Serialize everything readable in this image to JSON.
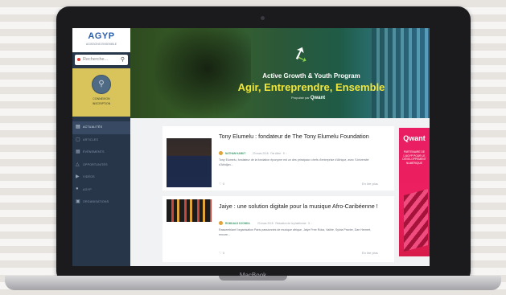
{
  "device": {
    "brand": "MacBook"
  },
  "sidebar": {
    "logo": "AGYP",
    "logo_sub": "AGISSONS ENSEMBLE",
    "search_placeholder": "Recherche...",
    "profile_lines": [
      "CONNEXION",
      "INSCRIPTION"
    ],
    "items": [
      {
        "icon": "news-icon",
        "label": "ACTUALITÉS"
      },
      {
        "icon": "doc-icon",
        "label": "ARTICLES"
      },
      {
        "icon": "calendar-icon",
        "label": "ÉVÉNEMENTS"
      },
      {
        "icon": "alert-icon",
        "label": "OPPORTUNITÉS"
      },
      {
        "icon": "video-icon",
        "label": "VIDÉOS"
      },
      {
        "icon": "info-icon",
        "label": "AGYP"
      },
      {
        "icon": "grid-icon",
        "label": "ORGANISATIONS"
      }
    ]
  },
  "hero": {
    "subtitle": "Active Growth & Youth Program",
    "title": "Agir, Entreprendre, Ensemble",
    "credit_prefix": "Propulsé par",
    "credit_brand": "Qwant"
  },
  "articles": [
    {
      "title": "Tony Elumelu : fondateur de The Tony Elumelu Foundation",
      "author": "NATHAN KABUT",
      "date": "23 mars 2018 · Par Aline · 5 ♡",
      "excerpt": "Tony Elumelu, fondateur de la fondation éponyme est un des principaux chefs d'entreprise d'Afrique, avec l'Université d'Abidjan...",
      "likes": "♡ 0",
      "read": "En lire plus"
    },
    {
      "title": "Jaiye : une solution digitale pour la musique Afro-Caribéenne !",
      "author": "ROMUALD DJONDA",
      "date": "23 mars 2018 · Rédaction de la plateforme · 5 ♡",
      "excerpt": "Rassemblant l'organisation Paris passionnés de musique afrique, Jaiye Free Roka, Vallée, Sylvia Pravier, Dan Hernert, encore...",
      "likes": "♡ 0",
      "read": "En lire plus"
    }
  ],
  "ad": {
    "brand": "Qwant",
    "text": "PARTENAIRE DE L'AGYP POUR LE DÉVELOPPEMENT NUMÉRIQUE"
  },
  "colors": {
    "sidebar": "#28364a",
    "profile": "#d8c45a",
    "hero_title": "#f2e638",
    "ad": "#e91e63",
    "accent": "#3a9a6a"
  }
}
